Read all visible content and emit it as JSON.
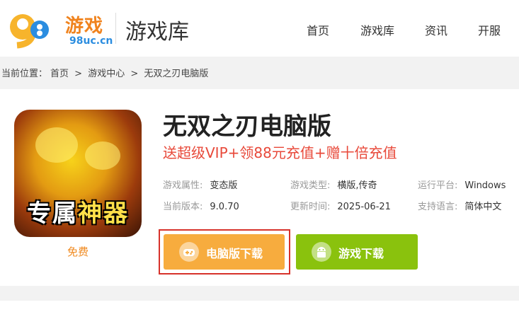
{
  "header": {
    "logo_text": "游戏",
    "logo_domain": "98uc.cn",
    "logo_numeral": "98",
    "title": "游戏库",
    "nav": [
      "首页",
      "游戏库",
      "资讯",
      "开服"
    ]
  },
  "breadcrumb": {
    "label": "当前位置：",
    "items": [
      "首页",
      "游戏中心",
      "无双之刃电脑版"
    ],
    "separator": ">"
  },
  "game": {
    "icon_caption_white": "专属",
    "icon_caption_yellow": "神器",
    "price": "免费",
    "title": "无双之刃电脑版",
    "promo": "送超级VIP+领88元充值+赠十倍充值",
    "info": [
      {
        "label": "游戏属性:",
        "value": "变态版"
      },
      {
        "label": "游戏类型:",
        "value": "横版,传奇"
      },
      {
        "label": "运行平台:",
        "value": "Windows"
      },
      {
        "label": "当前版本:",
        "value": "9.0.70"
      },
      {
        "label": "更新时间:",
        "value": "2025-06-21"
      },
      {
        "label": "支持语言:",
        "value": "简体中文"
      }
    ],
    "buttons": {
      "pc_download": "电脑版下载",
      "game_download": "游戏下载"
    }
  },
  "colors": {
    "brand_orange": "#f0831e",
    "brand_blue": "#2b8de0",
    "promo_red": "#e8493a",
    "pc_button": "#f7ac3e",
    "game_button": "#8ac20d",
    "highlight_border": "#d7322b"
  }
}
